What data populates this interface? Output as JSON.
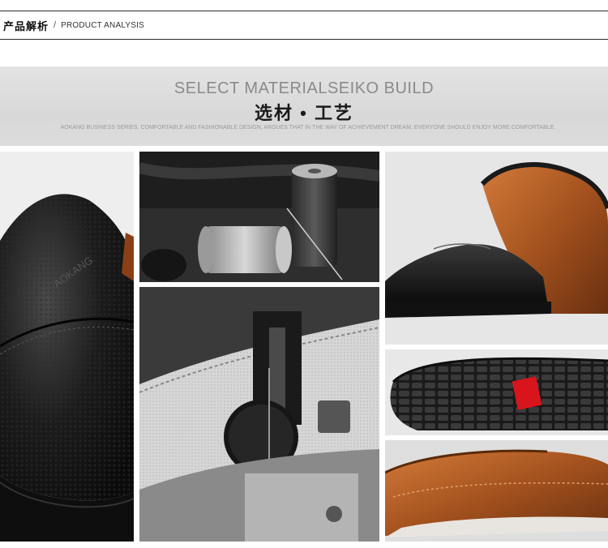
{
  "header": {
    "title_cn": "产品解析",
    "separator": "/",
    "title_en": "PRODUCT ANALYSIS"
  },
  "banner": {
    "title_en": "SELECT MATERIALSEIKO BUILD",
    "title_cn": "选材 • 工艺",
    "tagline": "AOKANG BUSINESS SERIES, COMFORTABLE AND FASHIONABLE DESIGN, ARGUES THAT IN THE WAY OF ACHIEVEMENT DREAM, EVERYONE SHOULD ENJOY MORE COMFORTABLE."
  },
  "photos": {
    "left_closeup_stamp": "AOKANG",
    "colors": {
      "black_leather": "#141414",
      "brown_leather": "#a4521e",
      "red_tag": "#d8141c",
      "thread_gray": "#b8b8b8"
    }
  }
}
